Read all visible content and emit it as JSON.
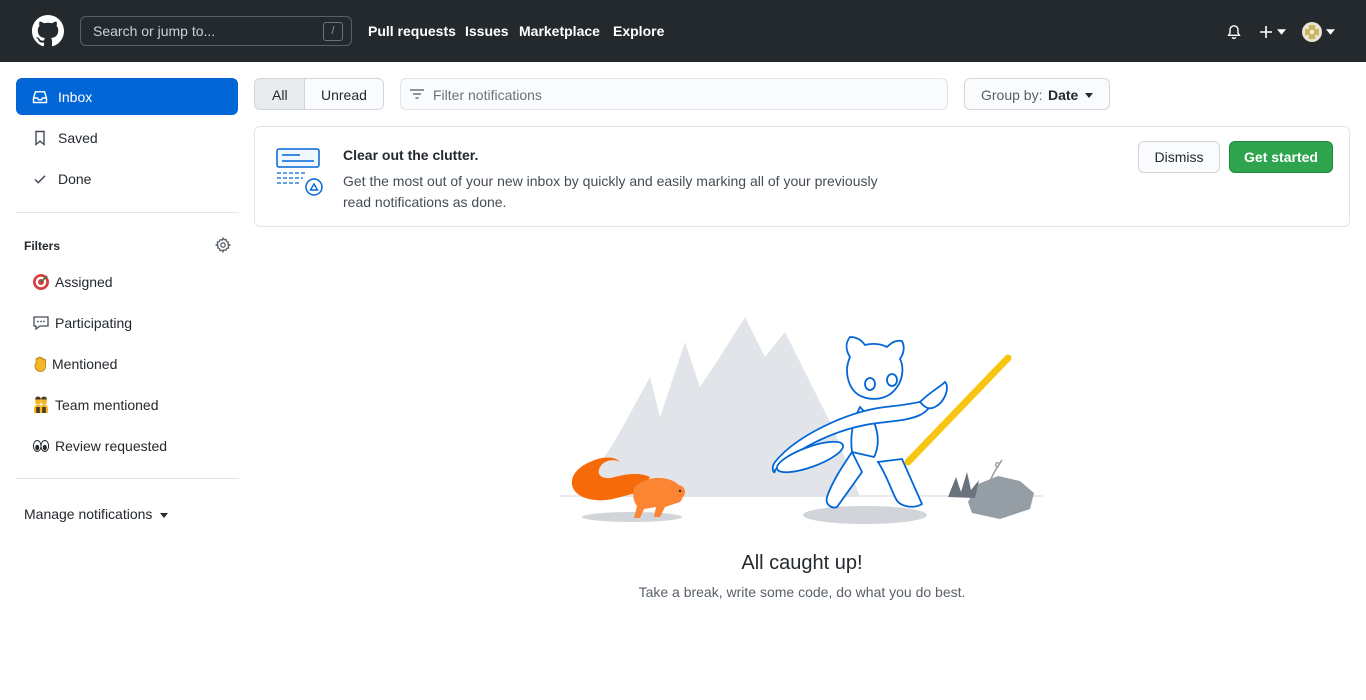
{
  "header": {
    "search_placeholder": "Search or jump to...",
    "search_shortcut": "/",
    "nav": [
      "Pull requests",
      "Issues",
      "Marketplace",
      "Explore"
    ]
  },
  "sidebar": {
    "items": [
      {
        "label": "Inbox",
        "icon": "inbox-icon",
        "active": true
      },
      {
        "label": "Saved",
        "icon": "bookmark-icon",
        "active": false
      },
      {
        "label": "Done",
        "icon": "check-icon",
        "active": false
      }
    ],
    "filters_title": "Filters",
    "filters": [
      {
        "label": "Assigned",
        "icon": "dart-emoji-icon"
      },
      {
        "label": "Participating",
        "icon": "speech-bubble-icon"
      },
      {
        "label": "Mentioned",
        "icon": "raised-hand-emoji-icon"
      },
      {
        "label": "Team mentioned",
        "icon": "people-emoji-icon"
      },
      {
        "label": "Review requested",
        "icon": "eyes-emoji-icon"
      }
    ],
    "manage": "Manage notifications"
  },
  "toolbar": {
    "tab_all": "All",
    "tab_unread": "Unread",
    "filter_placeholder": "Filter notifications",
    "group_prefix": "Group by:",
    "group_value": "Date"
  },
  "banner": {
    "title": "Clear out the clutter.",
    "body": "Get the most out of your new inbox by quickly and easily marking all of your previously read notifications as done.",
    "dismiss": "Dismiss",
    "get_started": "Get started"
  },
  "empty": {
    "title": "All caught up!",
    "subtitle": "Take a break, write some code, do what you do best."
  },
  "colors": {
    "header_bg": "#24292e",
    "accent_blue": "#0366d6",
    "primary_green": "#2ea44f"
  }
}
